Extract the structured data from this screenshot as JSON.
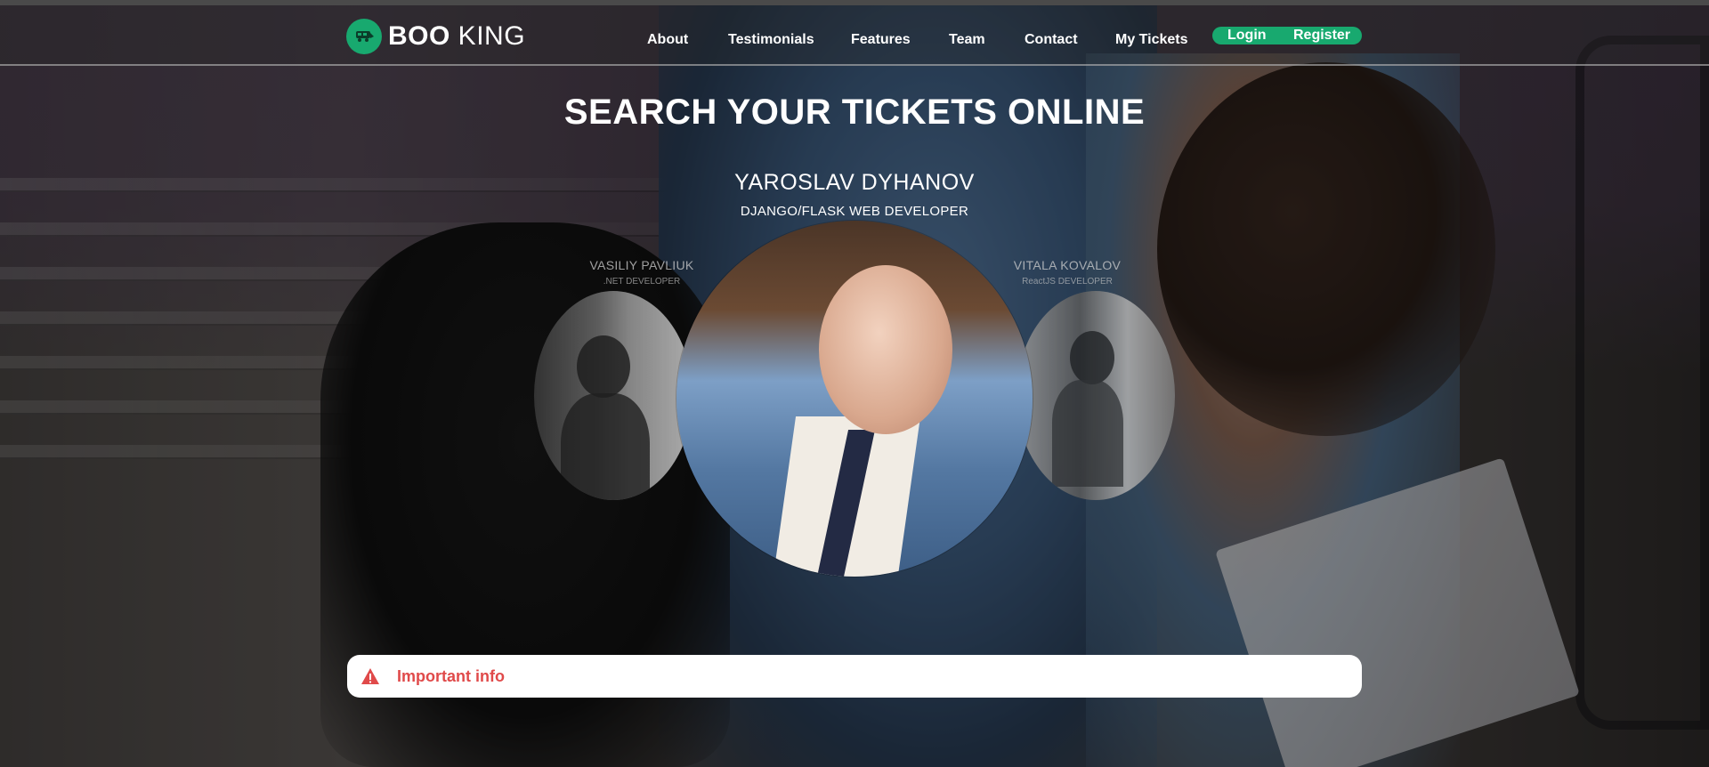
{
  "brand": {
    "name_bold": "BOO",
    "name_light": " KING"
  },
  "nav": {
    "items": [
      {
        "label": "About"
      },
      {
        "label": "Testimonials"
      },
      {
        "label": "Features"
      },
      {
        "label": "Team"
      },
      {
        "label": "Contact"
      },
      {
        "label": "My Tickets"
      }
    ],
    "login": "Login",
    "register": "Register"
  },
  "hero": {
    "title": "SEARCH YOUR TICKETS ONLINE"
  },
  "team": {
    "featured": {
      "name": "YAROSLAV DYHANOV",
      "role": "DJANGO/FLASK WEB DEVELOPER"
    },
    "left": {
      "name": "VASILIY PAVLIUK",
      "role": ".NET DEVELOPER"
    },
    "right": {
      "name": "VITALA KOVALOV",
      "role": "ReactJS DEVELOPER"
    }
  },
  "info": {
    "label": "Important info"
  },
  "colors": {
    "accent": "#18a96f",
    "warning": "#e04a4a"
  },
  "icons": {
    "logo": "train-icon",
    "info": "warning-triangle-icon"
  }
}
